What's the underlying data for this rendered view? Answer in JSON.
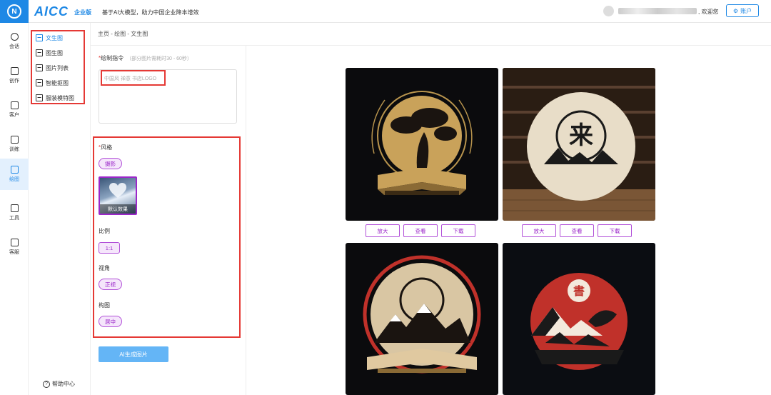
{
  "header": {
    "brand": "AICC",
    "edition": "企业版",
    "slogan": "基于AI大模型，助力中国企业降本增效",
    "welcome": ", 欢迎您",
    "account_label": "账户"
  },
  "rail": {
    "items": [
      {
        "label": "会话",
        "icon": "chat-icon"
      },
      {
        "label": "创作",
        "icon": "document-icon"
      },
      {
        "label": "客户",
        "icon": "contact-icon"
      },
      {
        "label": "训练",
        "icon": "file-icon"
      },
      {
        "label": "绘图",
        "icon": "image-icon"
      },
      {
        "label": "工具",
        "icon": "toolbox-icon"
      },
      {
        "label": "客服",
        "icon": "support-icon"
      }
    ]
  },
  "subnav": {
    "items": [
      {
        "label": "文生图"
      },
      {
        "label": "图生图"
      },
      {
        "label": "图片列表"
      },
      {
        "label": "智能抠图"
      },
      {
        "label": "服装模特图"
      }
    ],
    "help": "帮助中心"
  },
  "breadcrumb": "主页 - 绘图 - 文生图",
  "form": {
    "prompt_label": "绘制指令",
    "prompt_hint": "（部分图片需耗时30 - 60秒）",
    "prompt_value": "中国风 禅意 书店LOGO",
    "style_label": "风格",
    "style_value": "摄影",
    "style_thumb_caption": "默认效果",
    "ratio_label": "比例",
    "ratio_value": "1:1",
    "angle_label": "视角",
    "angle_value": "正视",
    "composition_label": "构图",
    "composition_value": "居中",
    "generate_label": "AI生成图片"
  },
  "results": {
    "actions": [
      "放大",
      "查看",
      "下载"
    ]
  },
  "colors": {
    "brand": "#1e88e5",
    "accent_purple": "#9b27c9",
    "highlight_red": "#e53935",
    "generate_button": "#64b5f6"
  }
}
